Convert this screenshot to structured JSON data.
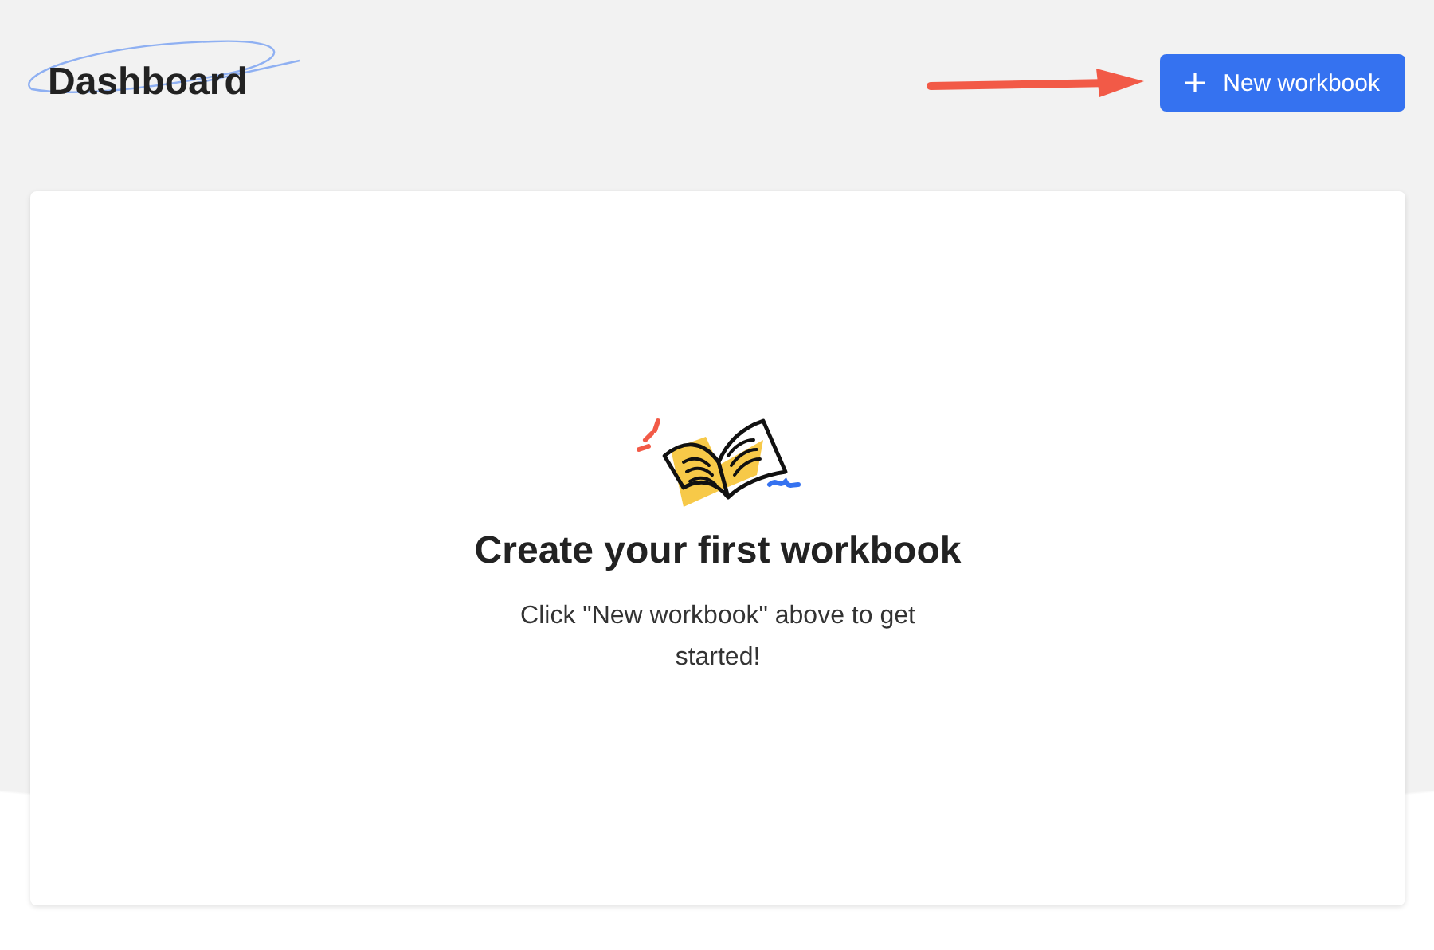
{
  "header": {
    "title": "Dashboard",
    "button": {
      "label": "New workbook"
    }
  },
  "empty_state": {
    "heading": "Create your first workbook",
    "message": "Click \"New workbook\" above to get started!"
  }
}
